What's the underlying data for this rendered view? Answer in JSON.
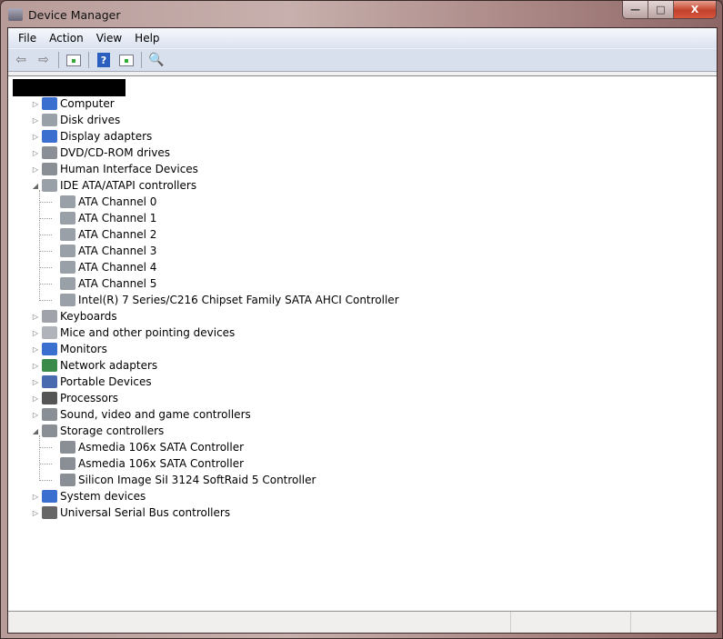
{
  "window": {
    "title": "Device Manager",
    "minimize": "—",
    "maximize": "□",
    "close": "X"
  },
  "menu": [
    "File",
    "Action",
    "View",
    "Help"
  ],
  "toolbar": {
    "icons": [
      "back-arrow-icon",
      "forward-arrow-icon",
      "show-hide-console-tree-icon",
      "help-icon",
      "show-action-pane-icon",
      "scan-hardware-icon"
    ],
    "help_glyph": "?"
  },
  "tree": [
    {
      "label": "Computer",
      "level": 0,
      "expanded": false,
      "icon": "computer-icon",
      "color": "#3a6fd0"
    },
    {
      "label": "Disk drives",
      "level": 0,
      "expanded": false,
      "icon": "disk-drive-icon",
      "color": "#9aa0a8"
    },
    {
      "label": "Display adapters",
      "level": 0,
      "expanded": false,
      "icon": "display-adapter-icon",
      "color": "#3a6fd0"
    },
    {
      "label": "DVD/CD-ROM drives",
      "level": 0,
      "expanded": false,
      "icon": "dvd-drive-icon",
      "color": "#8a8f96"
    },
    {
      "label": "Human Interface Devices",
      "level": 0,
      "expanded": false,
      "icon": "hid-icon",
      "color": "#8a8f96"
    },
    {
      "label": "IDE ATA/ATAPI controllers",
      "level": 0,
      "expanded": true,
      "icon": "ide-controller-icon",
      "color": "#9aa0a8"
    },
    {
      "label": "ATA Channel 0",
      "level": 1,
      "icon": "ide-controller-icon",
      "color": "#9aa0a8"
    },
    {
      "label": "ATA Channel 1",
      "level": 1,
      "icon": "ide-controller-icon",
      "color": "#9aa0a8"
    },
    {
      "label": "ATA Channel 2",
      "level": 1,
      "icon": "ide-controller-icon",
      "color": "#9aa0a8"
    },
    {
      "label": "ATA Channel 3",
      "level": 1,
      "icon": "ide-controller-icon",
      "color": "#9aa0a8"
    },
    {
      "label": "ATA Channel 4",
      "level": 1,
      "icon": "ide-controller-icon",
      "color": "#9aa0a8"
    },
    {
      "label": "ATA Channel 5",
      "level": 1,
      "icon": "ide-controller-icon",
      "color": "#9aa0a8"
    },
    {
      "label": "Intel(R) 7 Series/C216 Chipset Family SATA AHCI Controller",
      "level": 1,
      "icon": "ide-controller-icon",
      "color": "#9aa0a8"
    },
    {
      "label": "Keyboards",
      "level": 0,
      "expanded": false,
      "icon": "keyboard-icon",
      "color": "#a0a4aa"
    },
    {
      "label": "Mice and other pointing devices",
      "level": 0,
      "expanded": false,
      "icon": "mouse-icon",
      "color": "#b0b4ba"
    },
    {
      "label": "Monitors",
      "level": 0,
      "expanded": false,
      "icon": "monitor-icon",
      "color": "#3a6fd0"
    },
    {
      "label": "Network adapters",
      "level": 0,
      "expanded": false,
      "icon": "network-adapter-icon",
      "color": "#3a8a4a"
    },
    {
      "label": "Portable Devices",
      "level": 0,
      "expanded": false,
      "icon": "portable-device-icon",
      "color": "#4a6ab0"
    },
    {
      "label": "Processors",
      "level": 0,
      "expanded": false,
      "icon": "processor-icon",
      "color": "#555555"
    },
    {
      "label": "Sound, video and game controllers",
      "level": 0,
      "expanded": false,
      "icon": "speaker-icon",
      "color": "#8a8f96"
    },
    {
      "label": "Storage controllers",
      "level": 0,
      "expanded": true,
      "icon": "storage-controller-icon",
      "color": "#8a8f96"
    },
    {
      "label": "Asmedia 106x SATA Controller",
      "level": 1,
      "icon": "storage-controller-icon",
      "color": "#8a8f96"
    },
    {
      "label": "Asmedia 106x SATA Controller",
      "level": 1,
      "icon": "storage-controller-icon",
      "color": "#8a8f96"
    },
    {
      "label": "Silicon Image SiI 3124 SoftRaid 5 Controller",
      "level": 1,
      "icon": "storage-controller-icon",
      "color": "#8a8f96"
    },
    {
      "label": "System devices",
      "level": 0,
      "expanded": false,
      "icon": "system-device-icon",
      "color": "#3a6fd0"
    },
    {
      "label": "Universal Serial Bus controllers",
      "level": 0,
      "expanded": false,
      "icon": "usb-icon",
      "color": "#666666"
    }
  ]
}
